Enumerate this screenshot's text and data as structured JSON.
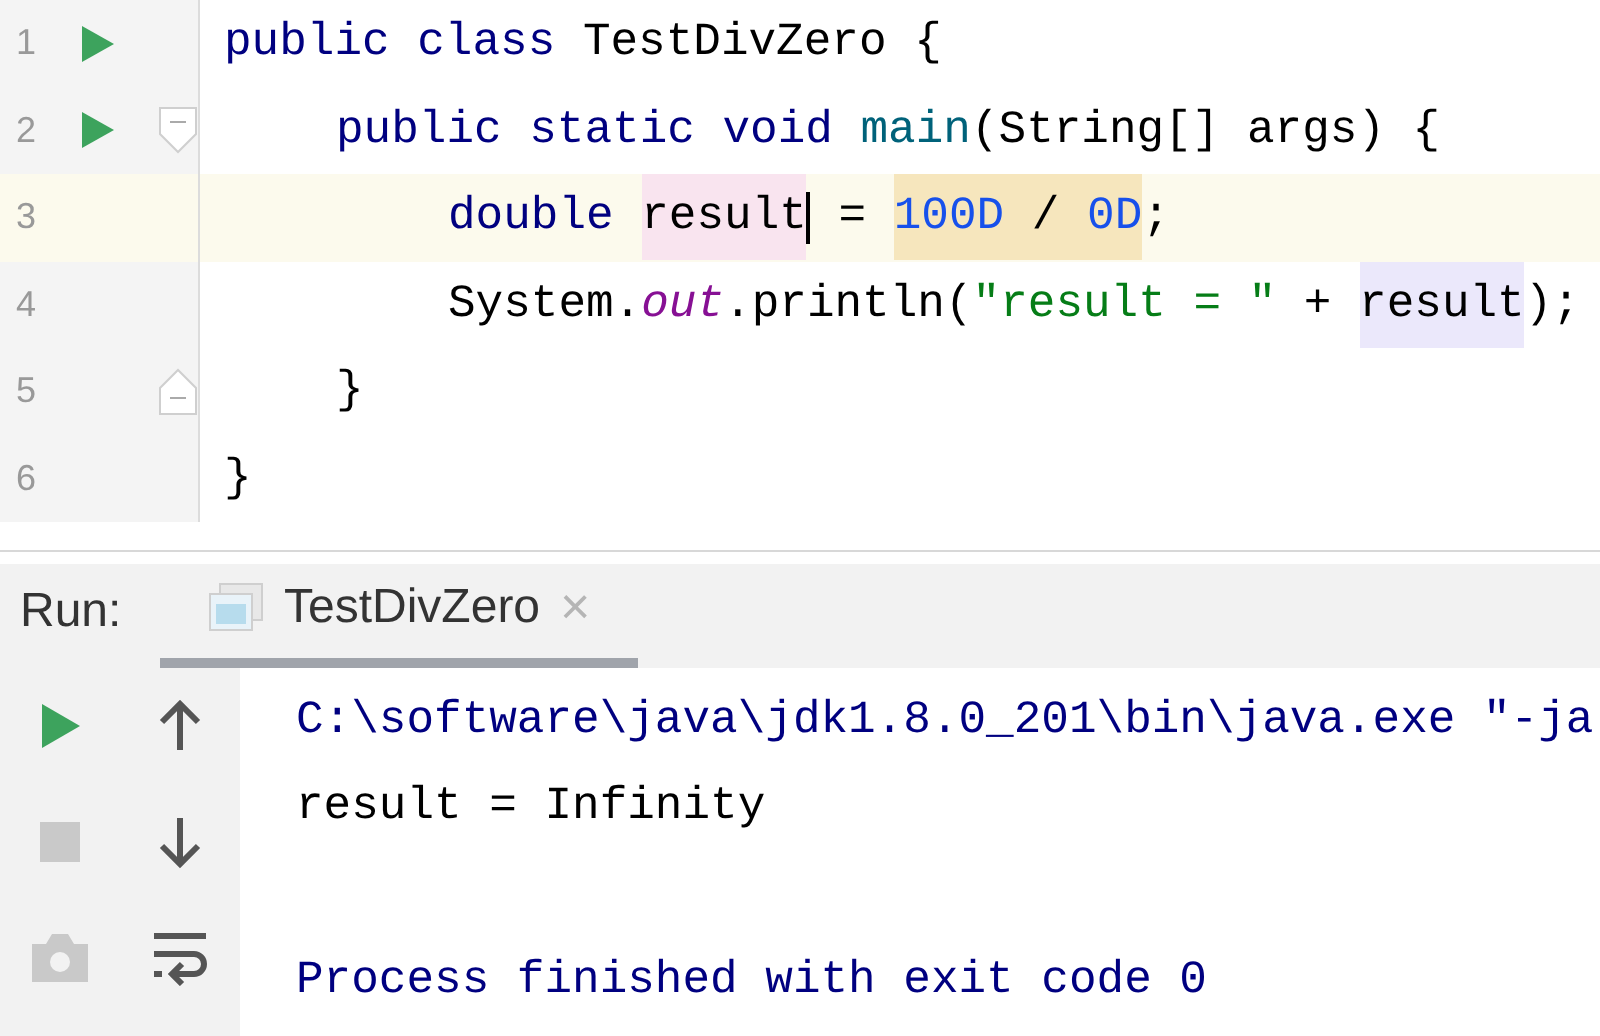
{
  "editor": {
    "lines": [
      {
        "number": "1",
        "run": true,
        "fold_start": false,
        "fold_end": false,
        "current": false,
        "tokens": [
          {
            "kind": "keyword",
            "text": "public class "
          },
          {
            "kind": "plain",
            "text": "TestDivZero {"
          }
        ],
        "children": [
          {
            "number": "2",
            "run": true,
            "fold_start": true,
            "fold_end": false,
            "current": false,
            "tokens": [
              {
                "kind": "keyword",
                "text": "public static void "
              },
              {
                "kind": "method",
                "text": "main"
              },
              {
                "kind": "plain",
                "text": "(String[] args) {"
              }
            ],
            "children": [
              {
                "number": "3",
                "run": false,
                "fold_start": false,
                "fold_end": false,
                "current": true,
                "tokens": [
                  {
                    "kind": "keyword",
                    "text": "double "
                  },
                  {
                    "kind": "plain",
                    "text": "result",
                    "color": "#f9e4ef"
                  },
                  {
                    "kind": "caret"
                  },
                  {
                    "kind": "plain",
                    "text": " = "
                  },
                  {
                    "kind": "number",
                    "text": "100D",
                    "color": "#f6e6bd"
                  },
                  {
                    "kind": "plain",
                    "text": " / ",
                    "color": "#f6e6bd"
                  },
                  {
                    "kind": "number",
                    "text": "0D",
                    "color": "#f6e6bd"
                  },
                  {
                    "kind": "plain",
                    "text": ";"
                  }
                ]
              },
              {
                "number": "4",
                "run": false,
                "fold_start": false,
                "fold_end": false,
                "current": false,
                "tokens": [
                  {
                    "kind": "plain",
                    "text": "System."
                  },
                  {
                    "kind": "field",
                    "text": "out"
                  },
                  {
                    "kind": "plain",
                    "text": ".println("
                  },
                  {
                    "kind": "string",
                    "text": "\"result = \""
                  },
                  {
                    "kind": "plain",
                    "text": " + "
                  },
                  {
                    "kind": "plain",
                    "text": "result",
                    "color": "#ebe8fb"
                  },
                  {
                    "kind": "plain",
                    "text": ");"
                  }
                ]
              }
            ]
          },
          {
            "number": "5",
            "run": false,
            "fold_start": false,
            "fold_end": true,
            "current": false,
            "tokens": [
              {
                "kind": "plain",
                "text": "}"
              }
            ]
          }
        ]
      },
      {
        "number": "6",
        "run": false,
        "fold_start": false,
        "fold_end": false,
        "current": false,
        "tokens": [
          {
            "kind": "plain",
            "text": "}"
          }
        ]
      }
    ]
  },
  "run_panel": {
    "label": "Run:",
    "tabs": [
      {
        "label": "TestDivZero",
        "selected": true,
        "close": "×"
      }
    ],
    "toolbar": [
      {
        "kind": "run",
        "disabled": false
      },
      {
        "kind": "up",
        "disabled": false
      },
      {
        "kind": "stop",
        "disabled": true
      },
      {
        "kind": "down",
        "disabled": false
      },
      {
        "kind": "camera",
        "disabled": true
      },
      {
        "kind": "wrap",
        "disabled": false
      }
    ],
    "console": [
      {
        "kind": "system",
        "text": "C:\\software\\java\\jdk1.8.0_201\\bin\\java.exe \"-ja"
      },
      {
        "kind": "output",
        "text": "result = Infinity"
      },
      {
        "kind": "blank"
      },
      {
        "kind": "system",
        "text": "Process finished with exit code 0"
      }
    ]
  }
}
